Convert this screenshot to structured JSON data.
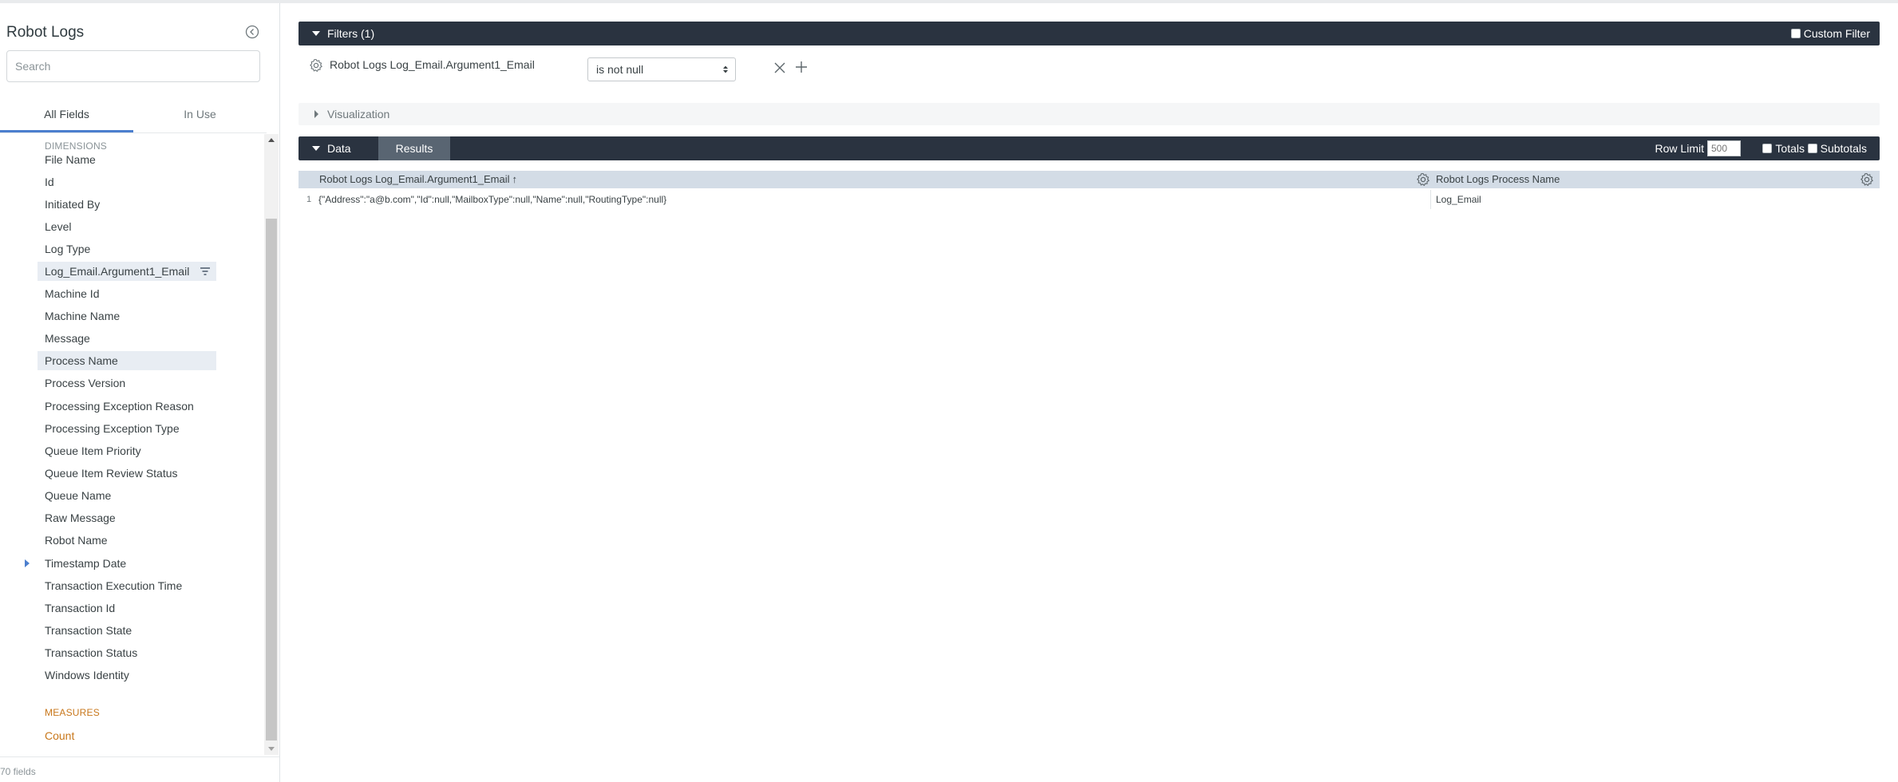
{
  "sidebar": {
    "title": "Robot Logs",
    "search_placeholder": "Search",
    "tabs": [
      "All Fields",
      "In Use"
    ],
    "dimensions_label": "DIMENSIONS",
    "dimensions": [
      "File Name",
      "Id",
      "Initiated By",
      "Level",
      "Log Type",
      "Log_Email.Argument1_Email",
      "Machine Id",
      "Machine Name",
      "Message",
      "Process Name",
      "Process Version",
      "Processing Exception Reason",
      "Processing Exception Type",
      "Queue Item Priority",
      "Queue Item Review Status",
      "Queue Name",
      "Raw Message",
      "Robot Name",
      "Timestamp Date",
      "Transaction Execution Time",
      "Transaction Id",
      "Transaction State",
      "Transaction Status",
      "Windows Identity"
    ],
    "measures_label": "MEASURES",
    "measures": [
      "Count"
    ],
    "field_count": "70 fields"
  },
  "filters": {
    "header": "Filters (1)",
    "custom_filter_label": "Custom Filter",
    "field_label": "Robot Logs Log_Email.Argument1_Email",
    "operator": "is not null"
  },
  "visualization": {
    "label": "Visualization"
  },
  "data_bar": {
    "data_label": "Data",
    "results_label": "Results",
    "row_limit_label": "Row Limit",
    "row_limit_value": "500",
    "totals_label": "Totals",
    "subtotals_label": "Subtotals"
  },
  "table": {
    "columns": [
      "Robot Logs Log_Email.Argument1_Email",
      "Robot Logs Process Name"
    ],
    "sort_indicator": "↑",
    "rows": [
      {
        "num": "1",
        "cells": [
          "{\"Address\":\"a@b.com\",\"Id\":null,\"MailboxType\":null,\"Name\":null,\"RoutingType\":null}",
          "Log_Email"
        ]
      }
    ]
  },
  "colors": {
    "header_bar": "#2a3340",
    "results_tab": "#596572",
    "table_header": "#d3dce6",
    "accent": "#4c7fce",
    "measure": "#c8771b"
  }
}
